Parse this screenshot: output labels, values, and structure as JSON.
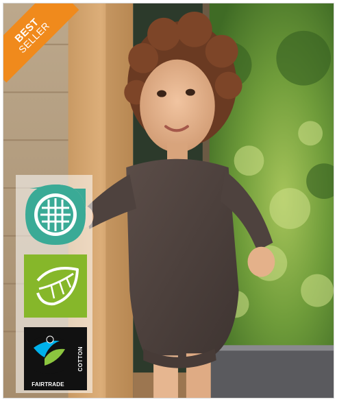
{
  "ribbon": {
    "line1": "BEST",
    "line2": "SELLER",
    "color": "#f08a1c"
  },
  "badges": [
    {
      "icon": "woven-fabric-icon",
      "color": "#3aaa96"
    },
    {
      "icon": "leaf-icon",
      "color": "#86b72a"
    },
    {
      "icon": "fairtrade-icon",
      "label": "FAIRTRADE",
      "sub_label": "COTTON"
    }
  ]
}
